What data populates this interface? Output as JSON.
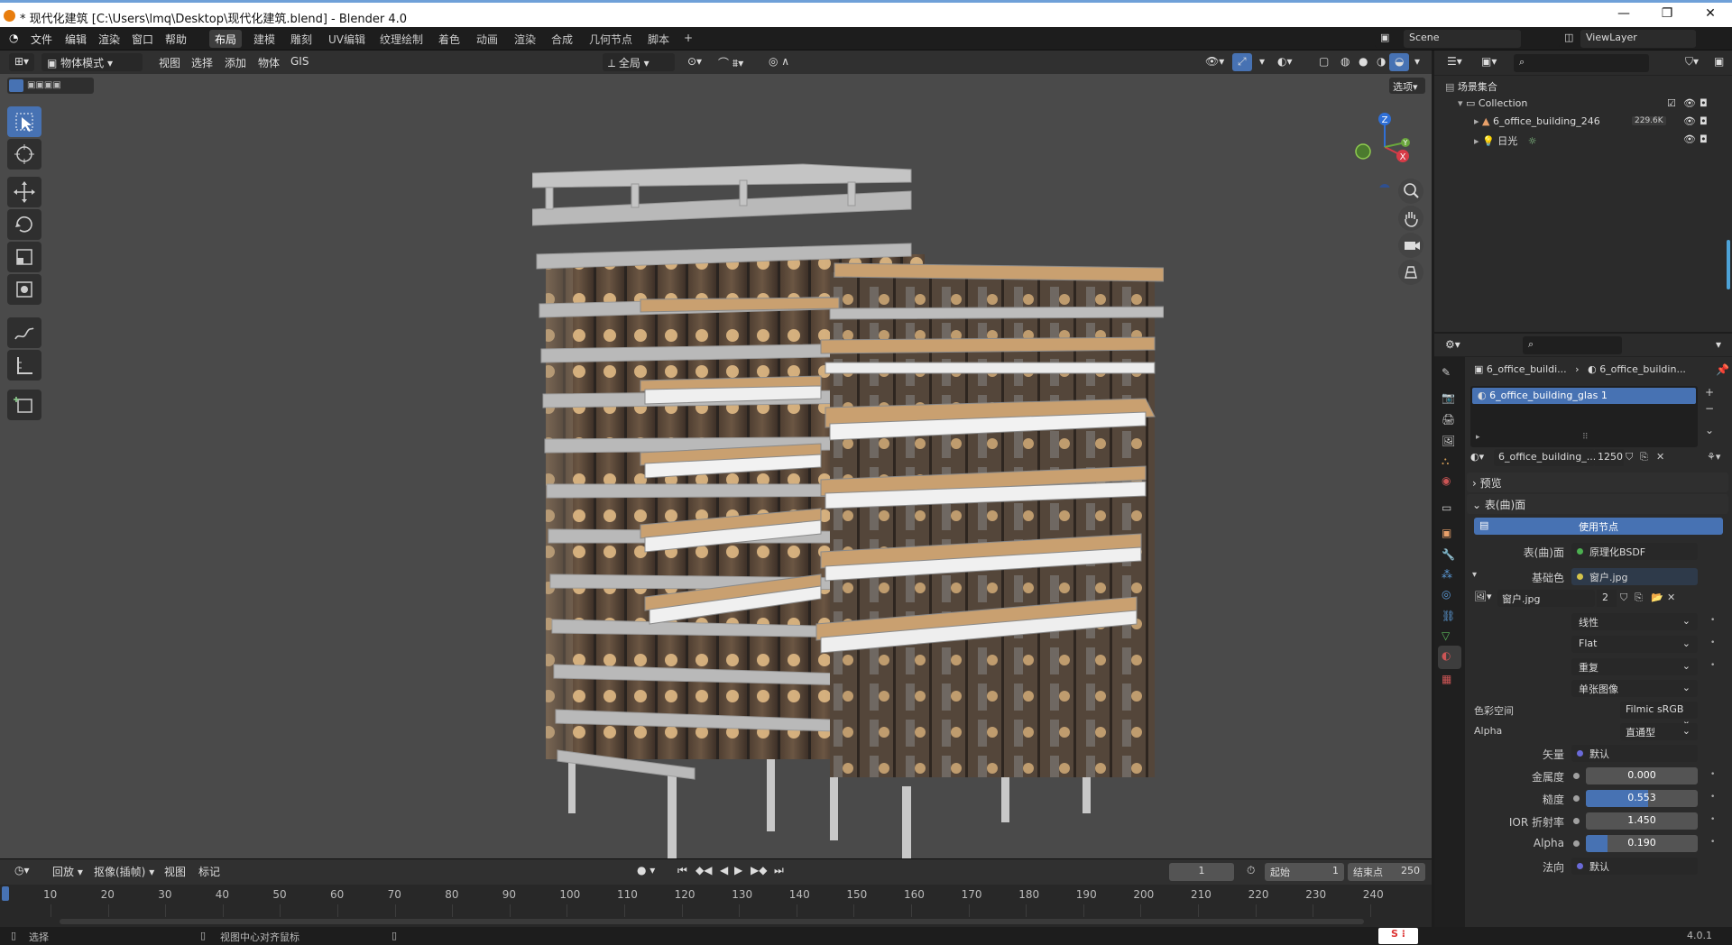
{
  "window": {
    "title": "* 现代化建筑 [C:\\Users\\lmq\\Desktop\\现代化建筑.blend] - Blender 4.0",
    "minimize": "—",
    "maximize": "❐",
    "close": "✕"
  },
  "menu": [
    "文件",
    "编辑",
    "渲染",
    "窗口",
    "帮助"
  ],
  "workspaces": [
    "布局",
    "建模",
    "雕刻",
    "UV编辑",
    "纹理绘制",
    "着色",
    "动画",
    "渲染",
    "合成",
    "几何节点",
    "脚本"
  ],
  "active_workspace": "布局",
  "add_workspace": "+",
  "scene": {
    "name": "Scene",
    "view_layer": "ViewLayer"
  },
  "viewport": {
    "mode": "物体模式",
    "menus": [
      "视图",
      "选择",
      "添加",
      "物体",
      "GIS"
    ],
    "transform_orientation": "全局",
    "options": "选项",
    "gizmo_axes": {
      "z": "Z",
      "y": "Y",
      "x": "X"
    }
  },
  "outliner": {
    "scene_collection": "场景集合",
    "collection": "Collection",
    "items": [
      {
        "name": "6_office_building_246",
        "badge": "229.6K"
      },
      {
        "name": "日光"
      }
    ]
  },
  "properties": {
    "breadcrumb_object": "6_office_buildi...",
    "breadcrumb_material": "6_office_buildin...",
    "material_slot": "6_office_building_glas 1",
    "material_name": "6_office_building_...",
    "material_users": "1250",
    "sections": {
      "preview": "预览",
      "surface": "表(曲)面"
    },
    "use_nodes": "使用节点",
    "surface_label": "表(曲)面",
    "surface_value": "原理化BSDF",
    "base_color_label": "基础色",
    "base_color_value": "窗户.jpg",
    "image_name": "窗户.jpg",
    "image_users": "2",
    "interpolation": "线性",
    "projection": "Flat",
    "extension": "重复",
    "source": "单张图像",
    "color_space_label": "色彩空间",
    "color_space_value": "Filmic sRGB",
    "alpha_label": "Alpha",
    "alpha_mode": "直通型",
    "vector_label": "矢量",
    "vector_value": "默认",
    "metallic_label": "金属度",
    "metallic_value": "0.000",
    "roughness_label": "糙度",
    "roughness_value": "0.553",
    "roughness": 0.553,
    "ior_label": "IOR 折射率",
    "ior_value": "1.450",
    "alpha2_label": "Alpha",
    "alpha2_value": "0.190",
    "alpha2": 0.19,
    "normal_label": "法向",
    "normal_value": "默认"
  },
  "timeline": {
    "menus": [
      "回放",
      "抠像(插帧)",
      "视图",
      "标记"
    ],
    "current_frame": "1",
    "start_label": "起始",
    "start": "1",
    "end_label": "结束点",
    "end": "250",
    "ticks": [
      "10",
      "20",
      "30",
      "40",
      "50",
      "60",
      "70",
      "80",
      "90",
      "100",
      "110",
      "120",
      "130",
      "140",
      "150",
      "160",
      "170",
      "180",
      "190",
      "200",
      "210",
      "220",
      "230",
      "240"
    ]
  },
  "status": {
    "select": "选择",
    "center": "视图中心对齐鼠标",
    "version": "4.0.1"
  },
  "colors": {
    "accent": "#4772b3",
    "header": "#303030",
    "panel": "#2b2b2b",
    "viewport_bg": "#4a4a4a",
    "brand": "#e87d0d"
  }
}
